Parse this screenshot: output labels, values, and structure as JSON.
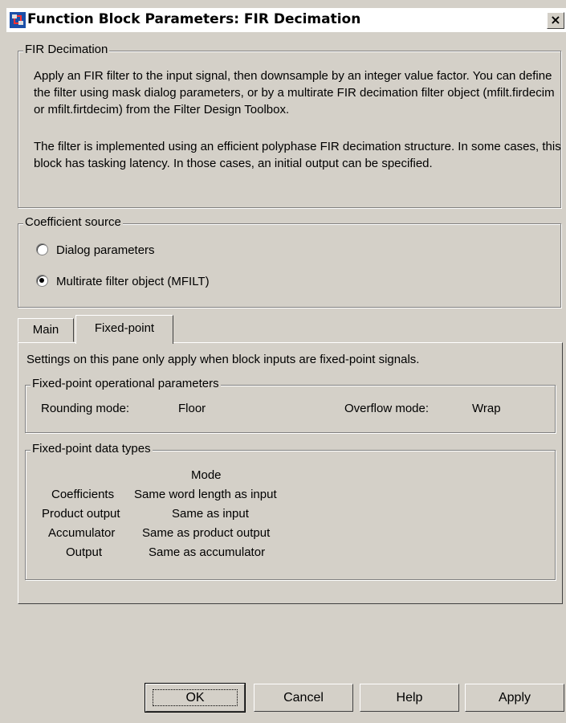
{
  "window": {
    "title": "Function Block Parameters: FIR Decimation",
    "close_label": "×"
  },
  "description": {
    "legend": "FIR Decimation",
    "paragraph1": "Apply an FIR filter to the input signal, then downsample by an integer value factor. You can define the filter using mask dialog parameters, or by a multirate FIR decimation filter object (mfilt.firdecim or mfilt.firtdecim) from the Filter Design Toolbox.",
    "paragraph2": "The filter is implemented using an efficient polyphase FIR decimation structure. In some cases, this block has tasking latency. In those cases, an initial output can be specified."
  },
  "coefficient_source": {
    "legend": "Coefficient source",
    "options": [
      {
        "label": "Dialog parameters",
        "selected": false
      },
      {
        "label": "Multirate filter object (MFILT)",
        "selected": true
      }
    ]
  },
  "tabs": [
    {
      "label": "Main",
      "active": false
    },
    {
      "label": "Fixed-point",
      "active": true
    }
  ],
  "fixed_point": {
    "intro": "Settings on this pane only apply when block inputs are fixed-point signals.",
    "operational": {
      "legend": "Fixed-point operational parameters",
      "rounding_label": "Rounding mode:",
      "rounding_value": "Floor",
      "overflow_label": "Overflow mode:",
      "overflow_value": "Wrap"
    },
    "data_types": {
      "legend": "Fixed-point data types",
      "mode_header": "Mode",
      "rows": [
        {
          "name": "Coefficients",
          "mode": "Same word length as input"
        },
        {
          "name": "Product output",
          "mode": "Same as input"
        },
        {
          "name": "Accumulator",
          "mode": "Same as product output"
        },
        {
          "name": "Output",
          "mode": "Same as accumulator"
        }
      ]
    }
  },
  "buttons": {
    "ok": "OK",
    "cancel": "Cancel",
    "help": "Help",
    "apply": "Apply"
  },
  "colors": {
    "face": "#d4d0c8",
    "shadow": "#808080",
    "dark": "#404040"
  }
}
